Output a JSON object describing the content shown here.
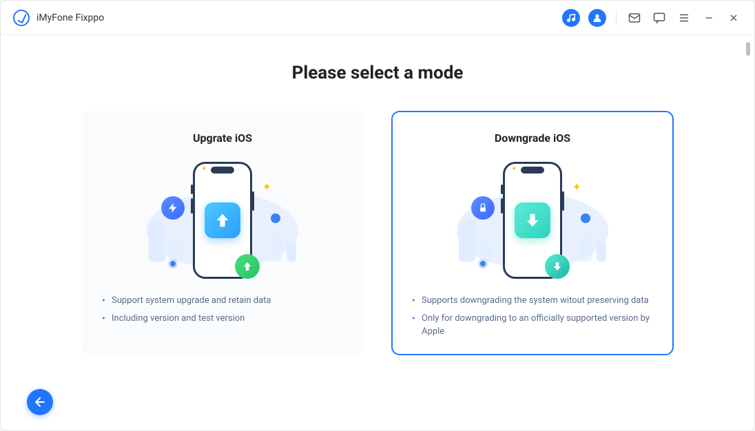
{
  "app": {
    "name": "iMyFone Fixppo"
  },
  "heading": "Please select a mode",
  "cards": {
    "upgrade": {
      "title": "Upgrate iOS",
      "bullets": [
        "Support system upgrade and retain data",
        "Including version and test version"
      ]
    },
    "downgrade": {
      "title": "Downgrade iOS",
      "bullets": [
        "Supports downgrading the system witout preserving data",
        "Only for downgrading to an officially supported version by Apple"
      ]
    }
  },
  "icons": {
    "music": "music-icon",
    "account": "account-icon",
    "mail": "mail-icon",
    "feedback": "feedback-icon",
    "menu": "menu-icon",
    "minimize": "minimize-icon",
    "close": "close-icon",
    "back": "back-icon"
  }
}
